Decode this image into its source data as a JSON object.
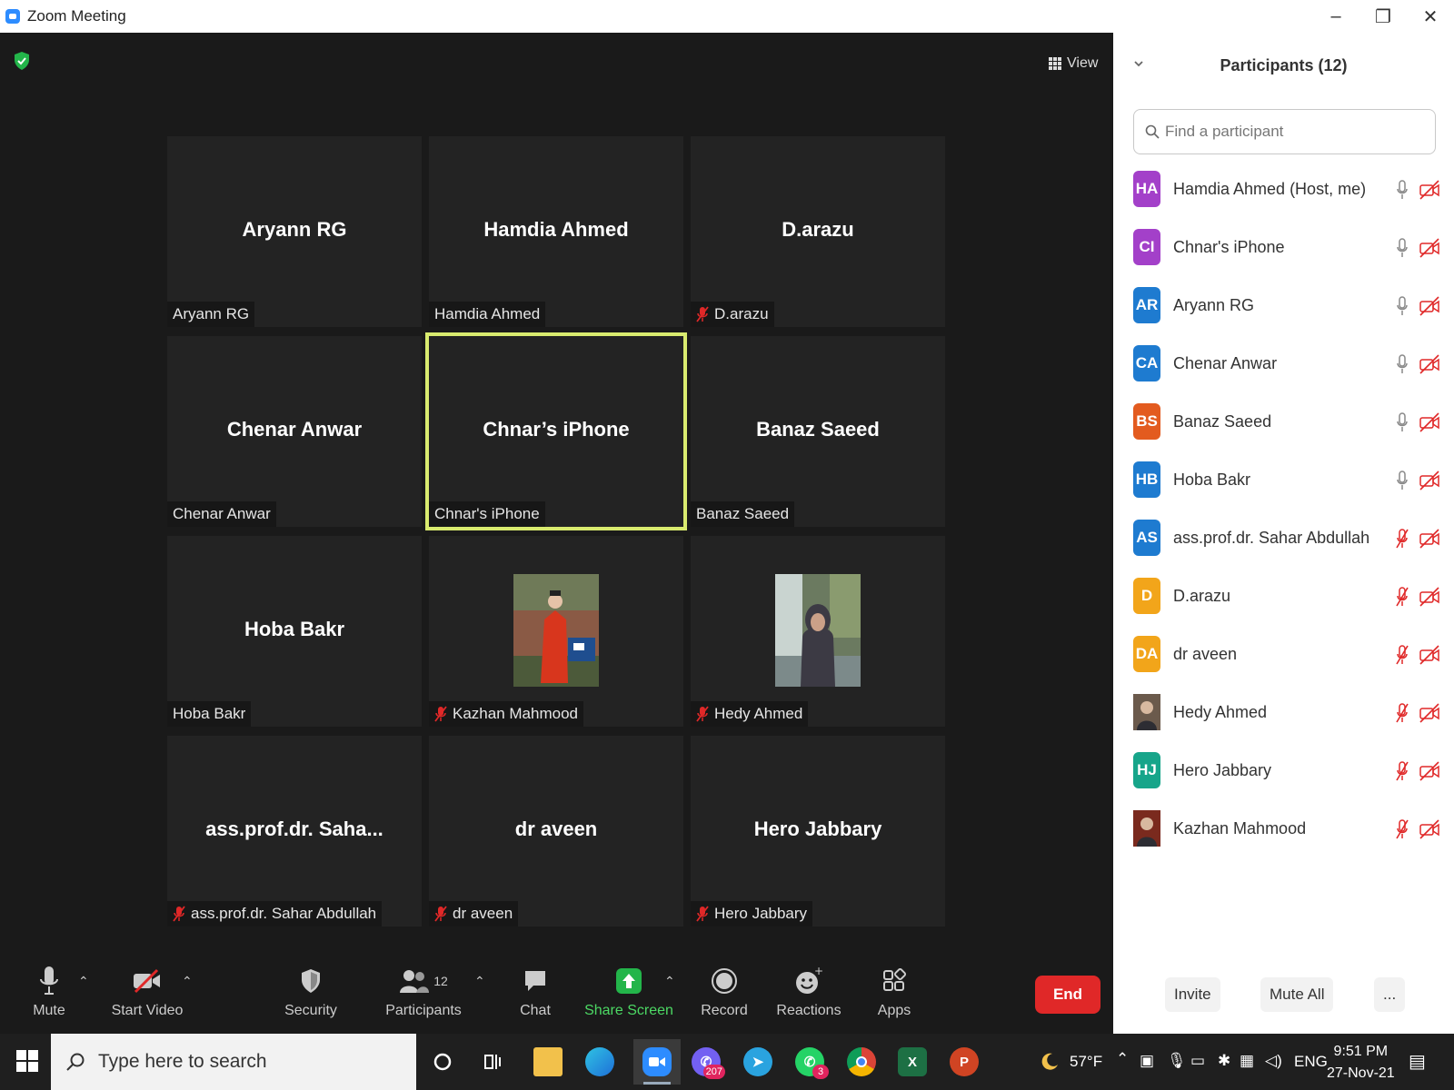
{
  "window": {
    "title": "Zoom Meeting",
    "controls": [
      "–",
      "❐",
      "✕"
    ]
  },
  "meeting": {
    "view_label": "View",
    "tiles": [
      {
        "name": "Aryann RG",
        "label": "Aryann RG",
        "muted": false,
        "photo": false,
        "active": false
      },
      {
        "name": "Hamdia Ahmed",
        "label": "Hamdia Ahmed",
        "muted": false,
        "photo": false,
        "active": false
      },
      {
        "name": "D.arazu",
        "label": "D.arazu",
        "muted": true,
        "photo": false,
        "active": false
      },
      {
        "name": "Chenar Anwar",
        "label": "Chenar Anwar",
        "muted": false,
        "photo": false,
        "active": false
      },
      {
        "name": "Chnar’s iPhone",
        "label": "Chnar's iPhone",
        "muted": false,
        "photo": false,
        "active": true
      },
      {
        "name": "Banaz Saeed",
        "label": "Banaz Saeed",
        "muted": false,
        "photo": false,
        "active": false
      },
      {
        "name": "Hoba Bakr",
        "label": "Hoba Bakr",
        "muted": false,
        "photo": false,
        "active": false
      },
      {
        "name": "",
        "label": "Kazhan Mahmood",
        "muted": true,
        "photo": true,
        "active": false
      },
      {
        "name": "",
        "label": "Hedy Ahmed",
        "muted": true,
        "photo": true,
        "active": false
      },
      {
        "name": "ass.prof.dr.  Saha...",
        "label": "ass.prof.dr. Sahar Abdullah",
        "muted": true,
        "photo": false,
        "active": false
      },
      {
        "name": "dr aveen",
        "label": "dr aveen",
        "muted": true,
        "photo": false,
        "active": false
      },
      {
        "name": "Hero Jabbary",
        "label": "Hero Jabbary",
        "muted": true,
        "photo": false,
        "active": false
      }
    ]
  },
  "toolbar": {
    "mute_label": "Mute",
    "video_label": "Start Video",
    "security_label": "Security",
    "participants_label": "Participants",
    "participants_count": "12",
    "chat_label": "Chat",
    "share_label": "Share Screen",
    "record_label": "Record",
    "reactions_label": "Reactions",
    "apps_label": "Apps",
    "end_label": "End"
  },
  "panel": {
    "title": "Participants (12)",
    "search_placeholder": "Find a participant",
    "participants": [
      {
        "initials": "HA",
        "name": "Hamdia Ahmed (Host, me)",
        "color": "#a340c9",
        "mic_muted": false,
        "photo": false
      },
      {
        "initials": "CI",
        "name": " Chnar's iPhone",
        "color": "#a340c9",
        "mic_muted": false,
        "photo": false
      },
      {
        "initials": "AR",
        "name": "Aryann RG",
        "color": "#1e7bd0",
        "mic_muted": false,
        "photo": false
      },
      {
        "initials": "CA",
        "name": "Chenar Anwar",
        "color": "#1e7bd0",
        "mic_muted": false,
        "photo": false
      },
      {
        "initials": "BS",
        "name": "Banaz Saeed",
        "color": "#e35b1f",
        "mic_muted": false,
        "photo": false
      },
      {
        "initials": "HB",
        "name": "Hoba Bakr",
        "color": "#1e7bd0",
        "mic_muted": false,
        "photo": false
      },
      {
        "initials": "AS",
        "name": "ass.prof.dr. Sahar Abdullah",
        "color": "#1e7bd0",
        "mic_muted": true,
        "photo": false
      },
      {
        "initials": "D",
        "name": "D.arazu",
        "color": "#f2a51a",
        "mic_muted": true,
        "photo": false
      },
      {
        "initials": "DA",
        "name": "dr aveen",
        "color": "#f2a51a",
        "mic_muted": true,
        "photo": false
      },
      {
        "initials": "",
        "name": "Hedy Ahmed",
        "color": "#6b5a4c",
        "mic_muted": true,
        "photo": true
      },
      {
        "initials": "HJ",
        "name": "Hero Jabbary",
        "color": "#17a58a",
        "mic_muted": true,
        "photo": false
      },
      {
        "initials": "",
        "name": "Kazhan Mahmood",
        "color": "#7a2a1e",
        "mic_muted": true,
        "photo": true
      }
    ],
    "invite_label": "Invite",
    "mute_all_label": "Mute All",
    "more_label": "..."
  },
  "taskbar": {
    "search_placeholder": "Type here to search",
    "viber_badge": "207",
    "whatsapp_badge": "3",
    "weather": "57°F",
    "language": "ENG",
    "time": "9:51 PM",
    "date": "27-Nov-21"
  }
}
